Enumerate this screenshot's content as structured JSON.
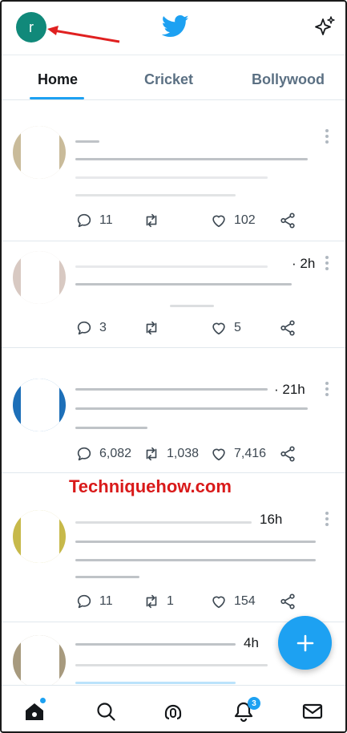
{
  "header": {
    "avatar_letter": "r",
    "logo_icon": "twitter-bird-icon",
    "sparkle_icon": "sparkle-icon"
  },
  "tabs": [
    {
      "label": "Home",
      "active": true
    },
    {
      "label": "Cricket",
      "active": false
    },
    {
      "label": "Bollywood",
      "active": false
    }
  ],
  "tweets": [
    {
      "time": "",
      "replies": "11",
      "retweets": "",
      "likes": "102"
    },
    {
      "time": "· 2h",
      "replies": "3",
      "retweets": "",
      "likes": "5"
    },
    {
      "time": "· 21h",
      "replies": "6,082",
      "retweets": "1,038",
      "likes": "7,416"
    },
    {
      "time": "16h",
      "replies": "11",
      "retweets": "1",
      "likes": "154"
    },
    {
      "time": "4h",
      "replies": "",
      "retweets": "",
      "likes": ""
    }
  ],
  "watermark": "Techniquehow.com",
  "bottom_nav": {
    "notifications_badge": "3"
  },
  "colors": {
    "accent": "#1da1f2",
    "avatar_bg": "#11897a",
    "watermark": "#d91a1a"
  }
}
